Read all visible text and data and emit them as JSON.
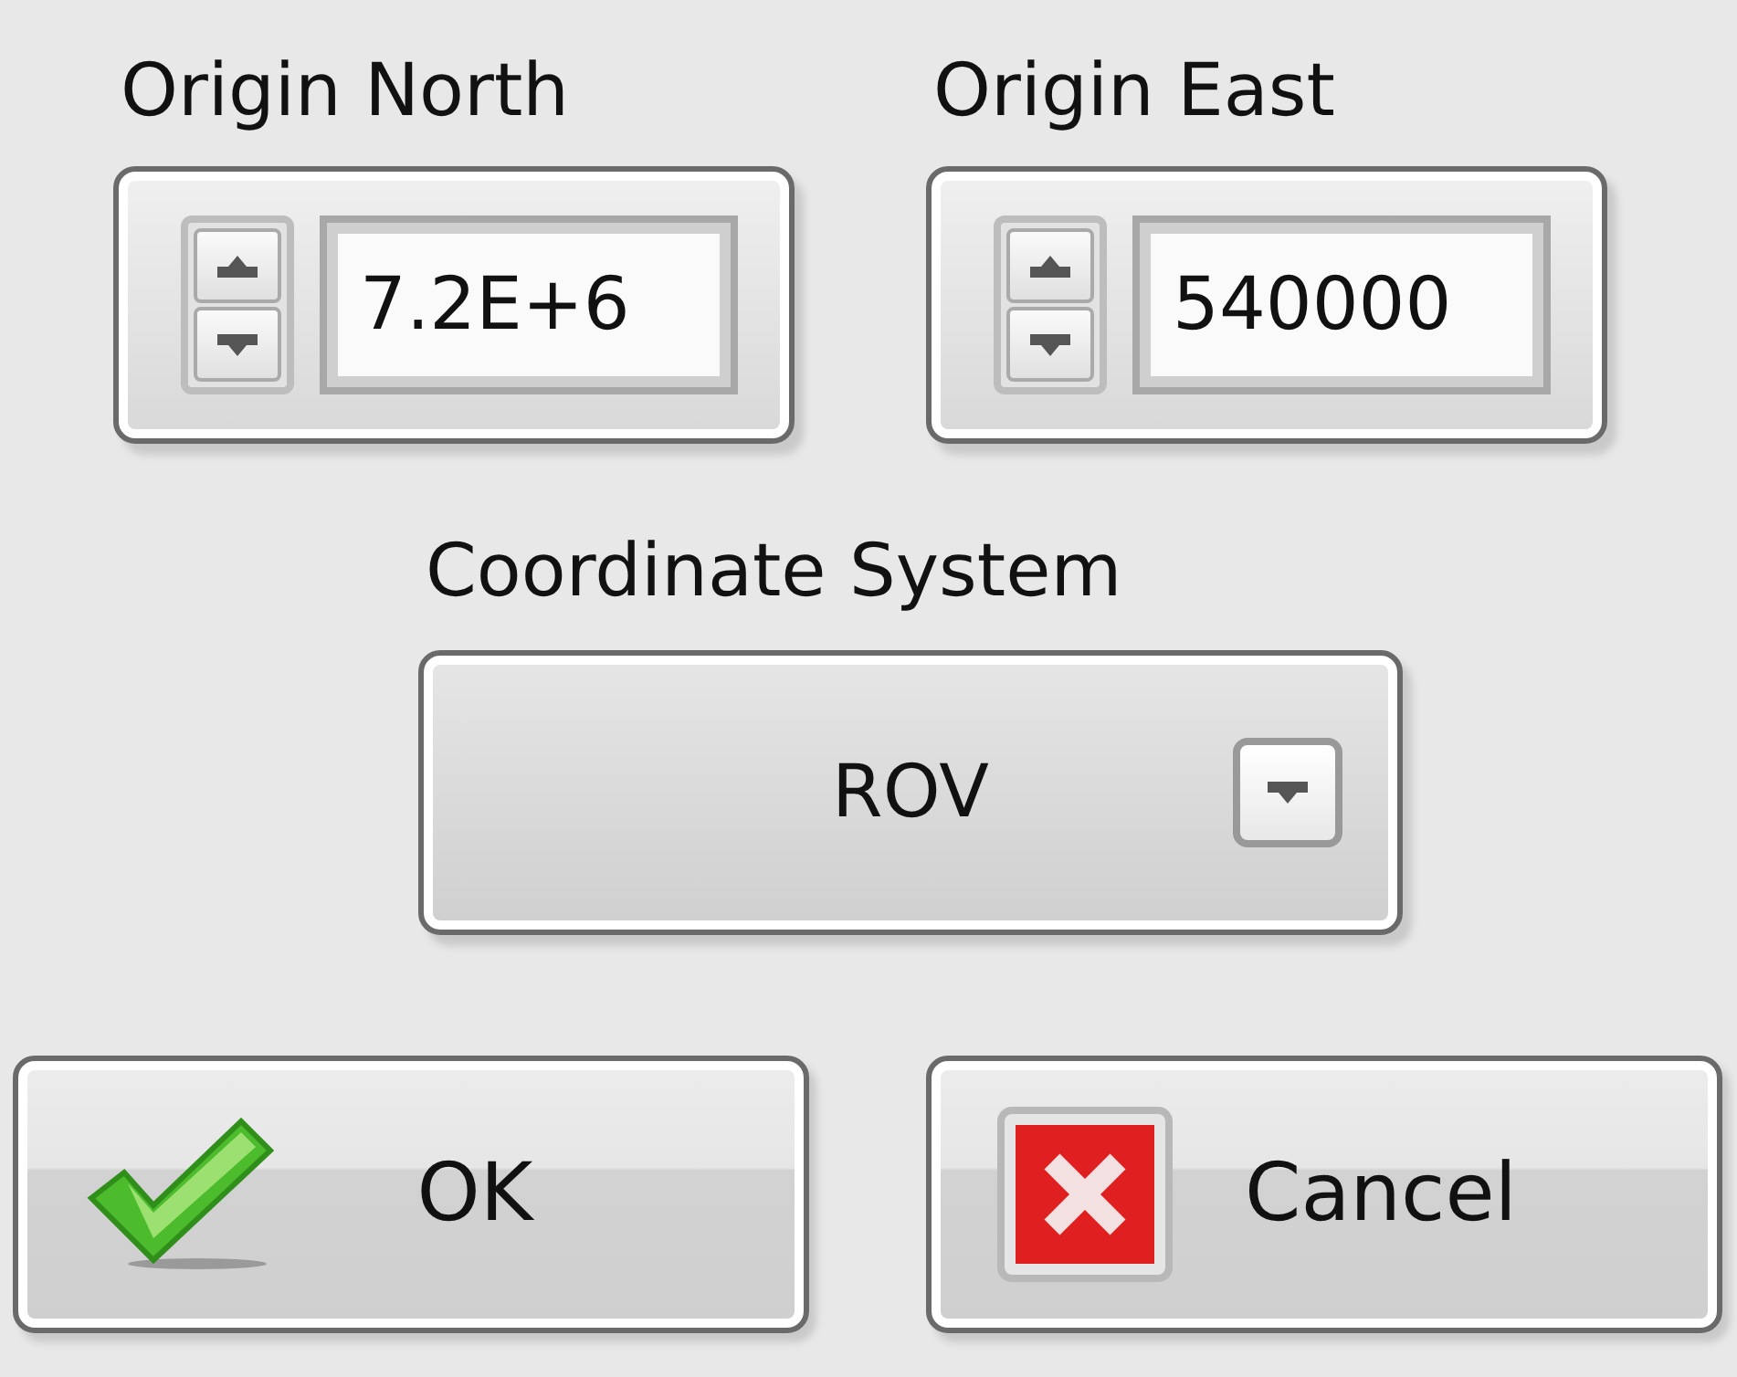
{
  "fields": [
    {
      "label": "Origin North",
      "value": "7.2E+6"
    },
    {
      "label": "Origin East",
      "value": "540000"
    }
  ],
  "coordinate_system": {
    "label": "Coordinate System",
    "value": "ROV"
  },
  "buttons": [
    {
      "label": "OK",
      "kind": "ok"
    },
    {
      "label": "Cancel",
      "kind": "cancel"
    }
  ]
}
